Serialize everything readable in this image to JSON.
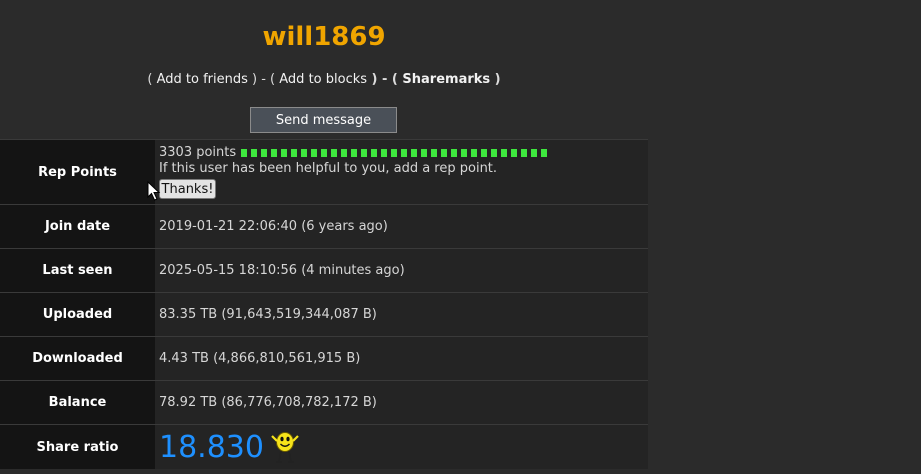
{
  "profile": {
    "username": "will1869",
    "actions": {
      "prefix": "( ",
      "add_to_friends": "Add to friends",
      "sep1": " ) - ( ",
      "add_to_blocks": "Add to blocks",
      "sep2": " ) - ( ",
      "sharemarks": "Sharemarks",
      "suffix": " )"
    },
    "send_message": "Send message"
  },
  "rows": {
    "rep": {
      "label": "Rep Points",
      "points_text": "3303 points",
      "help_text": "If this user has been helpful to you, add a rep point.",
      "thanks_button": "Thanks!"
    },
    "join": {
      "label": "Join date",
      "value": "2019-01-21 22:06:40 (6 years ago)"
    },
    "last_seen": {
      "label": "Last seen",
      "value": "2025-05-15 18:10:56 (4 minutes ago)"
    },
    "uploaded": {
      "label": "Uploaded",
      "value": "83.35 TB (91,643,519,344,087 B)"
    },
    "downloaded": {
      "label": "Downloaded",
      "value": "4.43 TB (4,866,810,561,915 B)"
    },
    "balance": {
      "label": "Balance",
      "value": "78.92 TB (86,776,708,782,172 B)"
    },
    "ratio": {
      "label": "Share ratio",
      "value": "18.830"
    }
  },
  "colors": {
    "username": "#f0a500",
    "ratio": "#1e90ff",
    "rep_bar": "#3ee83e"
  },
  "icons": {
    "smiley": "yellow-smiley-icon"
  }
}
